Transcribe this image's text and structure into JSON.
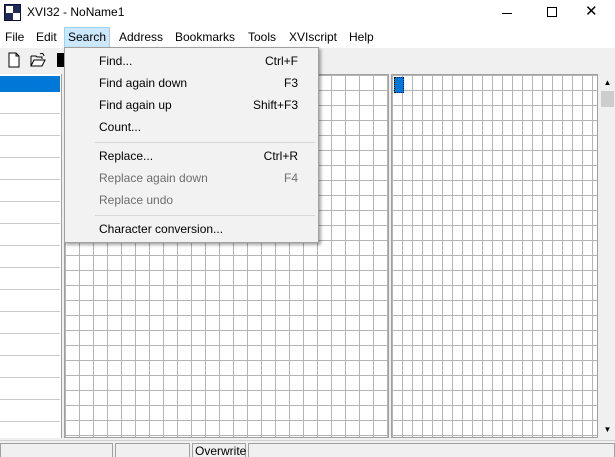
{
  "window": {
    "title": "XVI32 - NoName1"
  },
  "menubar": {
    "items": [
      {
        "label": "File"
      },
      {
        "label": "Edit"
      },
      {
        "label": "Search"
      },
      {
        "label": "Address"
      },
      {
        "label": "Bookmarks"
      },
      {
        "label": "Tools"
      },
      {
        "label": "XVIscript"
      },
      {
        "label": "Help"
      }
    ],
    "active": "Search"
  },
  "toolbar": {
    "icons": [
      "new-file-icon",
      "open-folder-icon",
      "save-disk-icon"
    ]
  },
  "search_menu": {
    "items": [
      {
        "label": "Find...",
        "shortcut": "Ctrl+F",
        "enabled": true
      },
      {
        "label": "Find again down",
        "shortcut": "F3",
        "enabled": true
      },
      {
        "label": "Find again up",
        "shortcut": "Shift+F3",
        "enabled": true
      },
      {
        "label": "Count...",
        "shortcut": "",
        "enabled": true
      },
      {
        "label": "Replace...",
        "shortcut": "Ctrl+R",
        "enabled": true
      },
      {
        "label": "Replace again down",
        "shortcut": "F4",
        "enabled": false
      },
      {
        "label": "Replace undo",
        "shortcut": "",
        "enabled": false
      },
      {
        "label": "Character conversion...",
        "shortcut": "",
        "enabled": true
      }
    ]
  },
  "statusbar": {
    "mode": "Overwrite"
  },
  "colors": {
    "selection": "#0078d7",
    "menu_highlight": "#cce8ff"
  }
}
